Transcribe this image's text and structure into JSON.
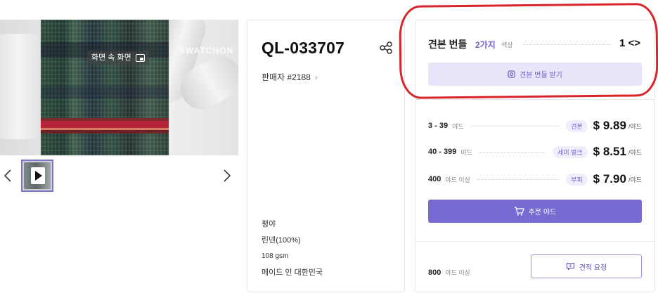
{
  "gallery": {
    "pip_label": "화면 속 화면",
    "watermark": "SWATCHON",
    "icons": {
      "prev": "chevron-left-icon",
      "next": "chevron-right-icon",
      "play": "play-icon",
      "pip": "picture-in-picture-icon"
    }
  },
  "product": {
    "code": "QL-033707",
    "seller": "판매자 #2188",
    "specs": [
      "평야",
      "린넨(100%)",
      "108 gsm",
      "메이드 인 대한민국"
    ],
    "icons": {
      "share": "share-icon",
      "seller_chevron": "chevron-right-icon"
    }
  },
  "swatch": {
    "title": "견본 번들",
    "count": "2가지",
    "count_suffix": "색상",
    "qty": "1",
    "qty_arrows": "<>",
    "button_label": "견본 번들 받기",
    "icon": "swatch-bundle-icon"
  },
  "pricing": {
    "tiers": [
      {
        "range": "3 - 39",
        "unit": "야드",
        "badge": "견본",
        "price": "$ 9.89",
        "per": "/야드"
      },
      {
        "range": "40 - 399",
        "unit": "야드",
        "badge": "세미 벌크",
        "price": "$ 8.51",
        "per": "/야드"
      },
      {
        "range": "400",
        "unit": "야드 이상",
        "badge": "부피",
        "price": "$ 7.90",
        "per": "/야드"
      }
    ],
    "order_button": "주문 야드",
    "bulk_qty": "800",
    "bulk_unit": "야드 이상",
    "quote_button": "견적 요청",
    "icons": {
      "cart": "cart-icon",
      "quote": "quote-request-icon"
    }
  },
  "colors": {
    "accent": "#776bd1",
    "accent_light": "#e8e5fb",
    "annotation": "#d8242b"
  }
}
